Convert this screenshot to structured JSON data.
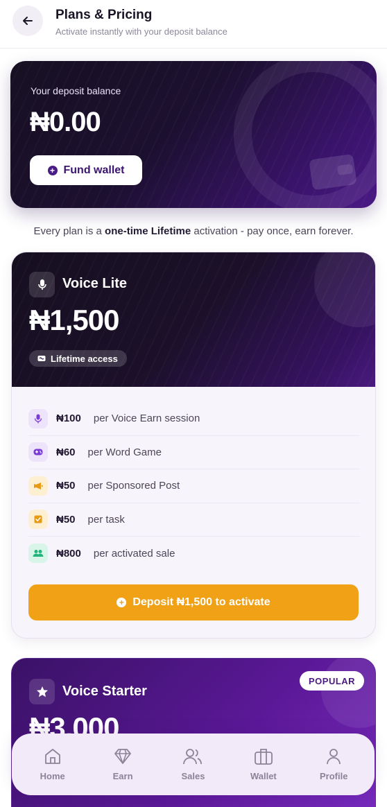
{
  "header": {
    "title": "Plans & Pricing",
    "subtitle": "Activate instantly with your deposit balance",
    "back_icon": "arrow-left-icon"
  },
  "balance": {
    "label": "Your deposit balance",
    "value": "₦0.00",
    "fund_label": "Fund wallet"
  },
  "note": {
    "prefix": "Every plan is a ",
    "bold": "one-time Lifetime",
    "suffix": " activation - pay once, earn forever."
  },
  "plans": [
    {
      "name": "Voice Lite",
      "price": "₦1,500",
      "badge": "Lifetime access",
      "icon": "microphone-icon",
      "rates": [
        {
          "amount": "₦100",
          "desc": "per Voice Earn session",
          "icon": "microphone-icon",
          "bg": "#ede4fb",
          "color": "#7c3bd6"
        },
        {
          "amount": "₦60",
          "desc": "per Word Game",
          "icon": "gamepad-icon",
          "bg": "#ede4fb",
          "color": "#7c3bd6"
        },
        {
          "amount": "₦50",
          "desc": "per Sponsored Post",
          "icon": "megaphone-icon",
          "bg": "#fdf0d2",
          "color": "#e79b14"
        },
        {
          "amount": "₦50",
          "desc": "per task",
          "icon": "task-check-icon",
          "bg": "#fdf0d2",
          "color": "#e79b14"
        },
        {
          "amount": "₦800",
          "desc": "per activated sale",
          "icon": "users-icon",
          "bg": "#d9f5ea",
          "color": "#22b47b"
        }
      ],
      "cta": "Deposit ₦1,500 to activate"
    },
    {
      "name": "Voice Starter",
      "price": "₦3,000",
      "badge": "POPULAR",
      "icon": "star-icon"
    }
  ],
  "nav": [
    {
      "label": "Home",
      "icon": "home-icon"
    },
    {
      "label": "Earn",
      "icon": "diamond-icon"
    },
    {
      "label": "Sales",
      "icon": "users-icon"
    },
    {
      "label": "Wallet",
      "icon": "briefcase-icon"
    },
    {
      "label": "Profile",
      "icon": "person-icon"
    }
  ],
  "colors": {
    "accent": "#4a1a82",
    "cta": "#f0a116",
    "card_dark": "#1b1029"
  }
}
